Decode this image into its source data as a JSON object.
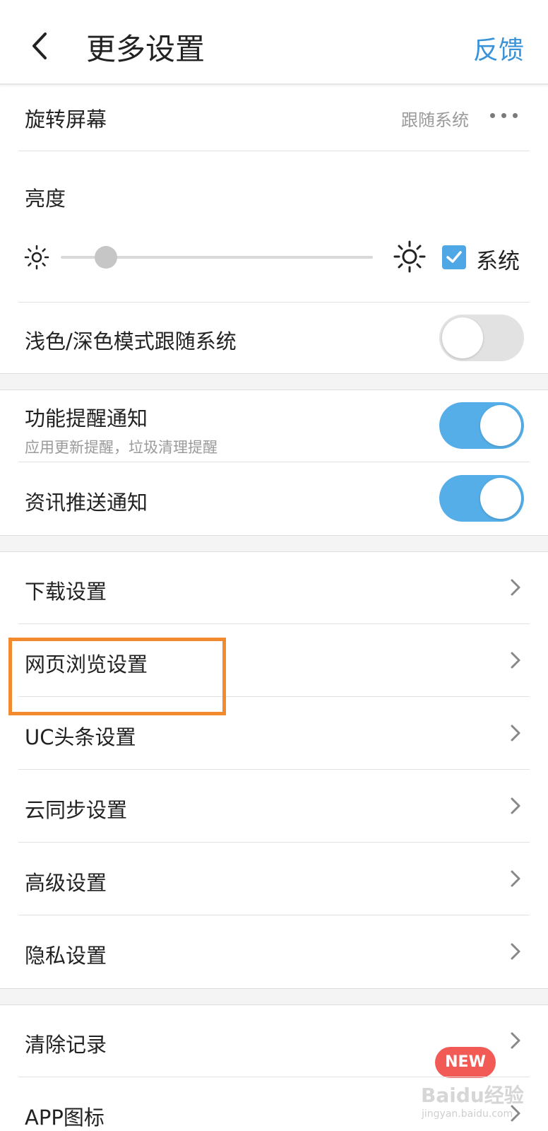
{
  "header": {
    "title": "更多设置",
    "feedback_label": "反馈"
  },
  "rotate": {
    "label": "旋转屏幕",
    "value": "跟随系统"
  },
  "brightness": {
    "label": "亮度",
    "level": 0.14,
    "system_label": "系统",
    "system_checked": true
  },
  "dark_mode": {
    "label": "浅色/深色模式跟随系统",
    "enabled": false
  },
  "notifications": [
    {
      "label": "功能提醒通知",
      "sublabel": "应用更新提醒，垃圾清理提醒",
      "enabled": true
    },
    {
      "label": "资讯推送通知",
      "enabled": true
    }
  ],
  "menu_items": [
    {
      "label": "下载设置"
    },
    {
      "label": "网页浏览设置"
    },
    {
      "label": "UC头条设置"
    },
    {
      "label": "云同步设置"
    },
    {
      "label": "高级设置"
    },
    {
      "label": "隐私设置"
    }
  ],
  "bottom_items": [
    {
      "label": "清除记录",
      "badge": "NEW"
    },
    {
      "label": "APP图标"
    }
  ],
  "watermark": {
    "text": "Baidu经验",
    "sub": "jingyan.baidu.com"
  },
  "colors": {
    "accent": "#3a93d8",
    "toggle_on": "#55aee8",
    "highlight": "#f28a30",
    "badge": "#f25a55"
  }
}
